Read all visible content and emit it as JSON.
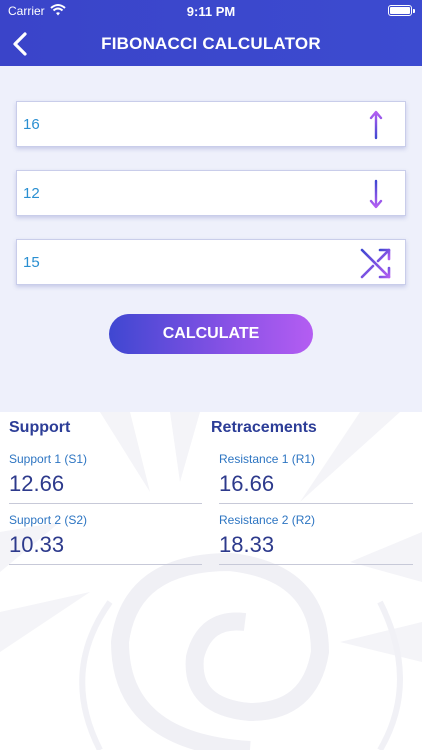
{
  "status_bar": {
    "carrier": "Carrier",
    "time": "9:11 PM"
  },
  "header": {
    "title": "FIBONACCI CALCULATOR"
  },
  "inputs": [
    {
      "value": "16",
      "icon": "arrow-up-icon"
    },
    {
      "value": "12",
      "icon": "arrow-down-icon"
    },
    {
      "value": "15",
      "icon": "shuffle-icon"
    }
  ],
  "calculate_label": "CALCULATE",
  "support": {
    "heading": "Support",
    "items": [
      {
        "label": "Support 1 (S1)",
        "value": "12.66"
      },
      {
        "label": "Support 2 (S2)",
        "value": "10.33"
      }
    ]
  },
  "retracements": {
    "heading": "Retracements",
    "items": [
      {
        "label": "Resistance 1 (R1)",
        "value": "16.66"
      },
      {
        "label": "Resistance 2 (R2)",
        "value": "18.33"
      }
    ]
  },
  "colors": {
    "header": "#3a44c9",
    "accent_start": "#3f47d1",
    "accent_end": "#b45df2",
    "value_text": "#2a8fd1"
  }
}
